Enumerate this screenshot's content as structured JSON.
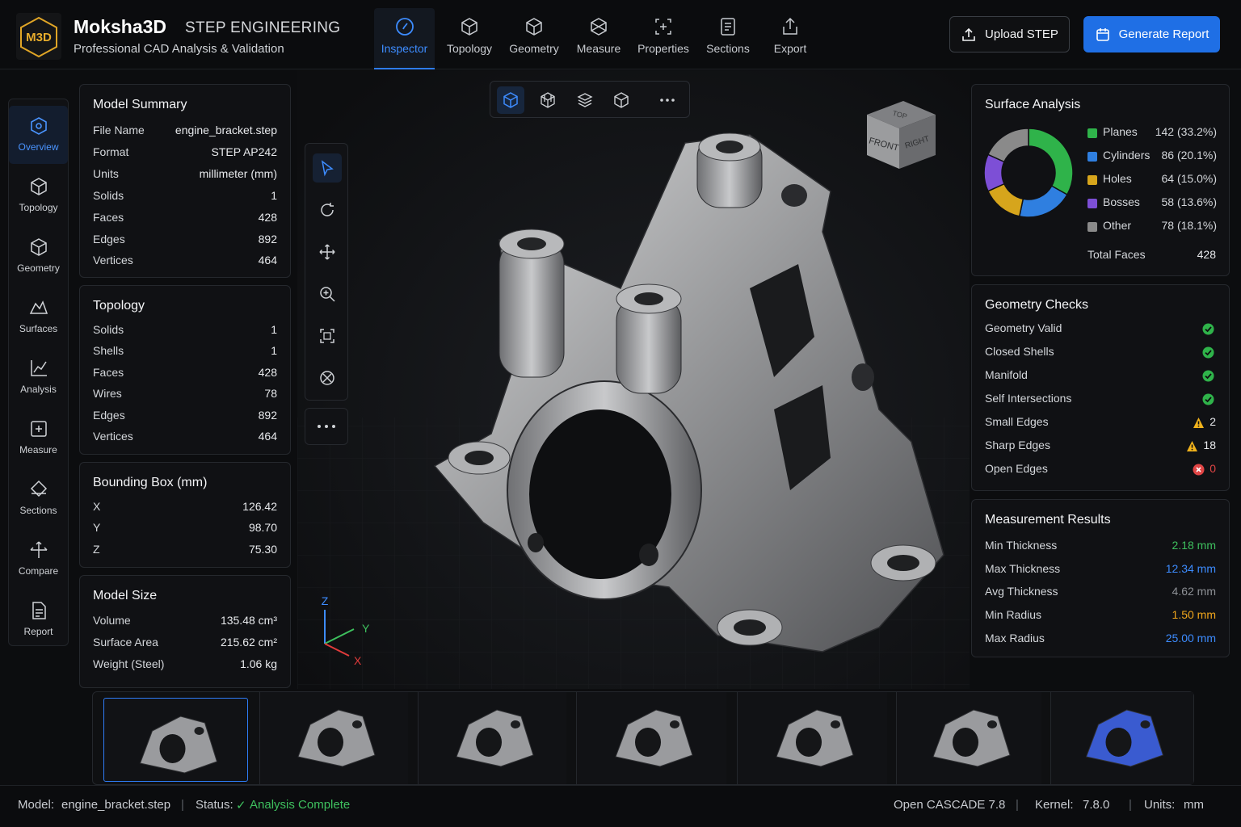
{
  "app": {
    "logo_text": "M3D",
    "name": "Moksha3D",
    "subtitle": "STEP ENGINEERING",
    "tagline": "Professional CAD Analysis & Validation"
  },
  "top_tabs": [
    {
      "label": "Inspector",
      "icon": "inspector-icon",
      "active": true
    },
    {
      "label": "Topology",
      "icon": "topology-icon"
    },
    {
      "label": "Geometry",
      "icon": "geometry-icon"
    },
    {
      "label": "Measure",
      "icon": "measure-icon"
    },
    {
      "label": "Properties",
      "icon": "properties-icon"
    },
    {
      "label": "Sections",
      "icon": "sections-icon"
    },
    {
      "label": "Export",
      "icon": "export-icon"
    }
  ],
  "actions": {
    "upload_label": "Upload STEP",
    "report_label": "Generate Report"
  },
  "left_nav": [
    {
      "label": "Overview",
      "icon": "overview-icon",
      "active": true
    },
    {
      "label": "Topology",
      "icon": "topology-icon"
    },
    {
      "label": "Geometry",
      "icon": "geometry-icon"
    },
    {
      "label": "Surfaces",
      "icon": "surfaces-icon"
    },
    {
      "label": "Analysis",
      "icon": "analysis-icon"
    },
    {
      "label": "Measure",
      "icon": "measure-icon"
    },
    {
      "label": "Sections",
      "icon": "sections-icon"
    },
    {
      "label": "Compare",
      "icon": "compare-icon"
    },
    {
      "label": "Report",
      "icon": "report-icon"
    }
  ],
  "model_summary": {
    "title": "Model Summary",
    "rows": [
      {
        "label": "File Name",
        "value": "engine_bracket.step"
      },
      {
        "label": "Format",
        "value": "STEP AP242"
      },
      {
        "label": "Units",
        "value": "millimeter (mm)"
      },
      {
        "label": "Solids",
        "value": "1"
      },
      {
        "label": "Faces",
        "value": "428"
      },
      {
        "label": "Edges",
        "value": "892"
      },
      {
        "label": "Vertices",
        "value": "464"
      }
    ]
  },
  "topology": {
    "title": "Topology",
    "rows": [
      {
        "label": "Solids",
        "value": "1"
      },
      {
        "label": "Shells",
        "value": "1"
      },
      {
        "label": "Faces",
        "value": "428"
      },
      {
        "label": "Wires",
        "value": "78"
      },
      {
        "label": "Edges",
        "value": "892"
      },
      {
        "label": "Vertices",
        "value": "464"
      }
    ]
  },
  "bounding_box": {
    "title": "Bounding Box (mm)",
    "rows": [
      {
        "label": "X",
        "value": "126.42"
      },
      {
        "label": "Y",
        "value": "98.70"
      },
      {
        "label": "Z",
        "value": "75.30"
      }
    ]
  },
  "model_size": {
    "title": "Model Size",
    "rows": [
      {
        "label": "Volume",
        "value": "135.48 cm³"
      },
      {
        "label": "Surface Area",
        "value": "215.62 cm²"
      },
      {
        "label": "Weight (Steel)",
        "value": "1.06 kg"
      }
    ]
  },
  "viewport": {
    "view_cube": {
      "top": "TOP",
      "front": "FRONT",
      "right": "RIGHT"
    },
    "axes": {
      "x": "X",
      "y": "Y",
      "z": "Z"
    },
    "view_toolbar": [
      "solid-view-icon",
      "wireframe-view-icon",
      "layers-view-icon",
      "iso-view-icon",
      "more-icon"
    ],
    "tools": [
      "select-icon",
      "rotate-icon",
      "pan-icon",
      "zoom-icon",
      "fit-icon",
      "reset-view-icon"
    ]
  },
  "surface_analysis": {
    "title": "Surface Analysis",
    "total_label": "Total Faces",
    "total_value": "428"
  },
  "chart_data": {
    "type": "pie",
    "categories": [
      "Planes",
      "Cylinders",
      "Holes",
      "Bosses",
      "Other"
    ],
    "values": [
      142,
      86,
      64,
      58,
      78
    ],
    "labels": [
      "142 (33.2%)",
      "86 (20.1%)",
      "64 (15.0%)",
      "58 (13.6%)",
      "78 (18.1%)"
    ],
    "colors": [
      "#2fb34a",
      "#2f7fe0",
      "#d6a51c",
      "#7d4fd6",
      "#8a8a8a"
    ],
    "donut": true,
    "legend": "right"
  },
  "geometry_checks": {
    "title": "Geometry Checks",
    "rows": [
      {
        "label": "Geometry Valid",
        "status": "ok",
        "count": ""
      },
      {
        "label": "Closed Shells",
        "status": "ok",
        "count": ""
      },
      {
        "label": "Manifold",
        "status": "ok",
        "count": ""
      },
      {
        "label": "Self Intersections",
        "status": "ok",
        "count": ""
      },
      {
        "label": "Small Edges",
        "status": "warn",
        "count": "2"
      },
      {
        "label": "Sharp Edges",
        "status": "warn",
        "count": "18"
      },
      {
        "label": "Open Edges",
        "status": "error",
        "count": "0"
      }
    ]
  },
  "measurement_results": {
    "title": "Measurement Results",
    "rows": [
      {
        "label": "Min Thickness",
        "value": "2.18 mm",
        "color": "#3ec05e"
      },
      {
        "label": "Max Thickness",
        "value": "12.34 mm",
        "color": "#3d8cff"
      },
      {
        "label": "Avg Thickness",
        "value": "4.62 mm",
        "color": "#8e9196"
      },
      {
        "label": "Min Radius",
        "value": "1.50 mm",
        "color": "#f0a61c"
      },
      {
        "label": "Max Radius",
        "value": "25.00 mm",
        "color": "#3d8cff"
      }
    ]
  },
  "thumbnails": [
    "view-iso-1",
    "view-front",
    "view-top",
    "view-iso-2",
    "view-iso-3",
    "view-side",
    "view-section"
  ],
  "status_bar": {
    "model_label": "Model:",
    "model_value": "engine_bracket.step",
    "status_label": "Status:",
    "status_value": "Analysis Complete",
    "engine": "Open CASCADE 7.8",
    "kernel_label": "Kernel:",
    "kernel_value": "7.8.0",
    "units_label": "Units:",
    "units_value": "mm"
  }
}
